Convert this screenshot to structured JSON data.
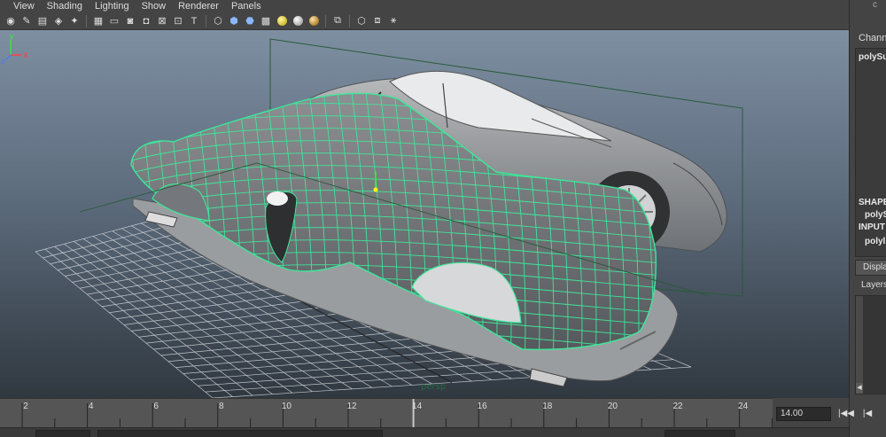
{
  "menu": [
    "View",
    "Shading",
    "Lighting",
    "Show",
    "Renderer",
    "Panels"
  ],
  "toolbar_icons": [
    "camera-icon",
    "camera-attributes-icon",
    "bookmark-icon",
    "image-plane-icon",
    "2d-pan-zoom-icon",
    "sep",
    "grid-icon",
    "film-gate-icon",
    "resolution-gate-icon",
    "gate-mask-icon",
    "field-chart-icon",
    "safe-action-icon",
    "safe-title-icon",
    "sep",
    "wireframe-icon",
    "smooth-shade-icon",
    "wireframe-on-shaded-icon",
    "textured-icon",
    "default-light-icon",
    "use-all-lights-icon",
    "shadows-icon",
    "sep",
    "isolate-select-icon",
    "sep",
    "xray-icon",
    "xray-joints-icon",
    "xray-components-icon"
  ],
  "right_panel": {
    "top_label": "c",
    "channels_header": "Channe",
    "object_name": "polySu",
    "shapes_label": "SHAPE",
    "shape_item": "polyS",
    "inputs_label": "INPUT",
    "input_item": "polyl",
    "tab_label": "Displa",
    "layers_label": "Layers"
  },
  "timeline": {
    "ticks": [
      "2",
      "4",
      "6",
      "8",
      "10",
      "12",
      "14",
      "16",
      "18",
      "20",
      "22",
      "24"
    ],
    "current_time": "14.00"
  },
  "colors": {
    "wireframe": "#3ee69a",
    "viewport_top": "#7e8fa2",
    "viewport_bottom": "#303840",
    "panel_bg": "#444444"
  },
  "axis": {
    "x": "x",
    "y": "y",
    "z": "z"
  }
}
